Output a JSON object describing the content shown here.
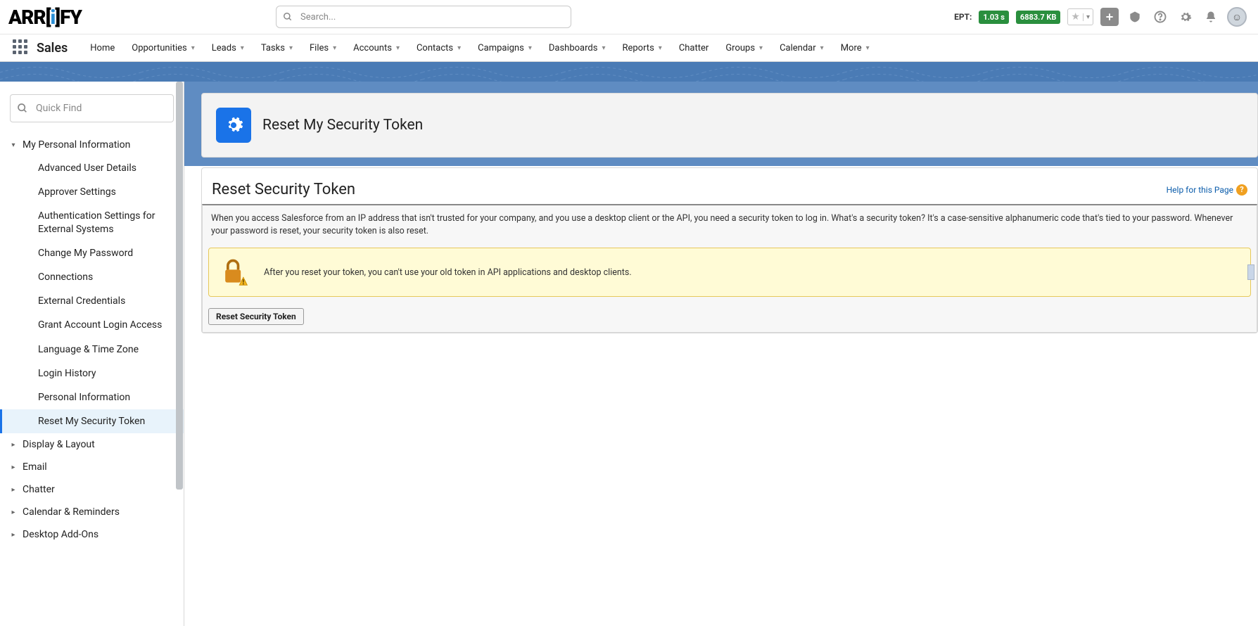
{
  "header": {
    "search_placeholder": "Search...",
    "ept_label": "EPT:",
    "ept_time": "1.03 s",
    "ept_size": "6883.7 KB"
  },
  "nav": {
    "app_name": "Sales",
    "items": [
      "Home",
      "Opportunities",
      "Leads",
      "Tasks",
      "Files",
      "Accounts",
      "Contacts",
      "Campaigns",
      "Dashboards",
      "Reports",
      "Chatter",
      "Groups",
      "Calendar",
      "More"
    ]
  },
  "sidebar": {
    "quick_find_placeholder": "Quick Find",
    "section_expanded": "My Personal Information",
    "sub_items": [
      "Advanced User Details",
      "Approver Settings",
      "Authentication Settings for External Systems",
      "Change My Password",
      "Connections",
      "External Credentials",
      "Grant Account Login Access",
      "Language & Time Zone",
      "Login History",
      "Personal Information",
      "Reset My Security Token"
    ],
    "collapsed": [
      "Display & Layout",
      "Email",
      "Chatter",
      "Calendar & Reminders",
      "Desktop Add-Ons"
    ]
  },
  "page": {
    "header_title": "Reset My Security Token",
    "body_title": "Reset Security Token",
    "help_link": "Help for this Page",
    "description": "When you access Salesforce from an IP address that isn't trusted for your company, and you use a desktop client or the API, you need a security token to log in. What's a security token? It's a case-sensitive alphanumeric code that's tied to your password. Whenever your password is reset, your security token is also reset.",
    "warning": "After you reset your token, you can't use your old token in API applications and desktop clients.",
    "reset_button": "Reset Security Token"
  }
}
